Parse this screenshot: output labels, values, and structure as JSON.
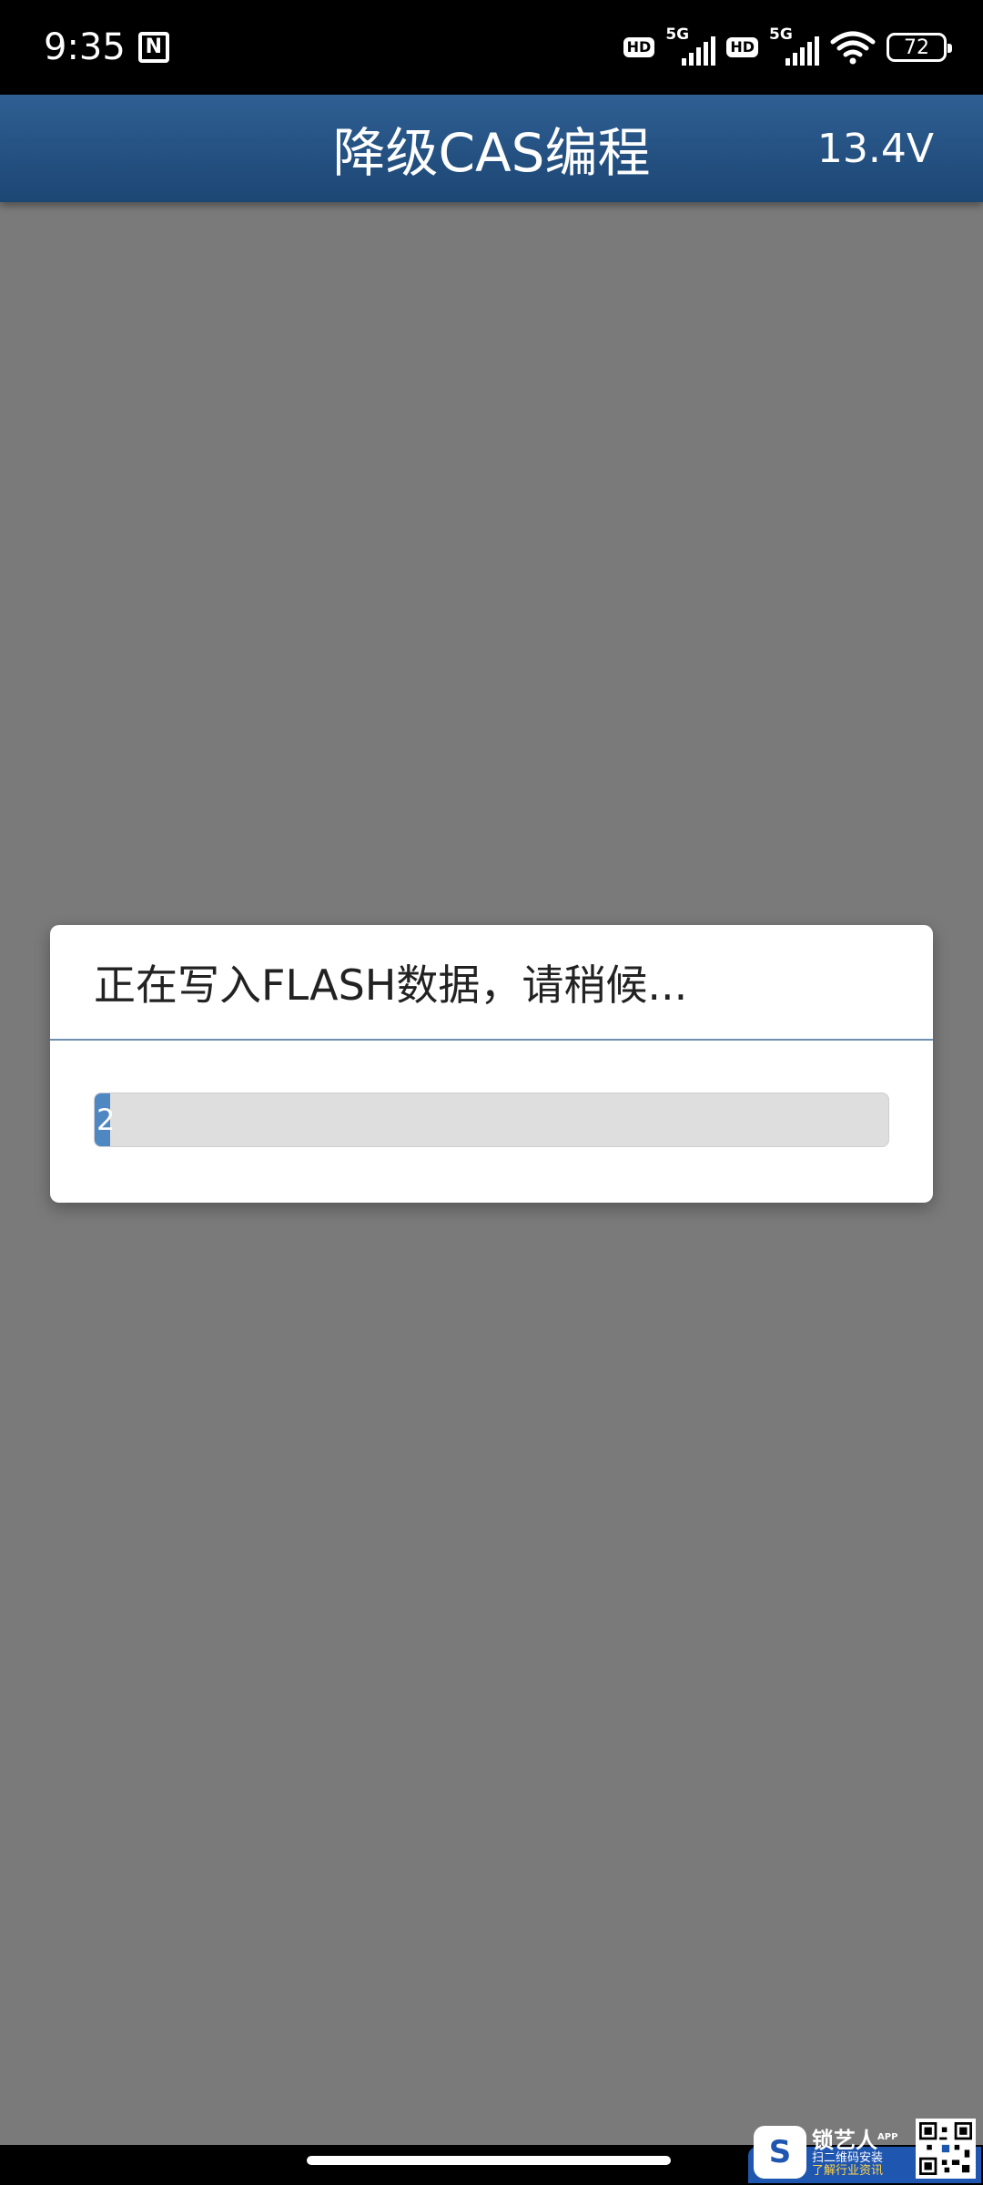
{
  "status_bar": {
    "time": "9:35",
    "network_1": "5G",
    "network_2": "5G",
    "hd_1": "HD",
    "hd_2": "HD",
    "battery": "72"
  },
  "header": {
    "title": "降级CAS编程",
    "voltage": "13.4V"
  },
  "dialog": {
    "message": "正在写入FLASH数据，请稍候...",
    "progress_text": "2",
    "progress_percent": 2
  },
  "ad": {
    "brand": "锁艺人",
    "app_tag": "APP",
    "line1": "扫二维码安装",
    "line2": "了解行业资讯"
  },
  "colors": {
    "header": "#1c4674",
    "progress_fill": "#4f87c2",
    "overlay": "#7a7a7a"
  }
}
